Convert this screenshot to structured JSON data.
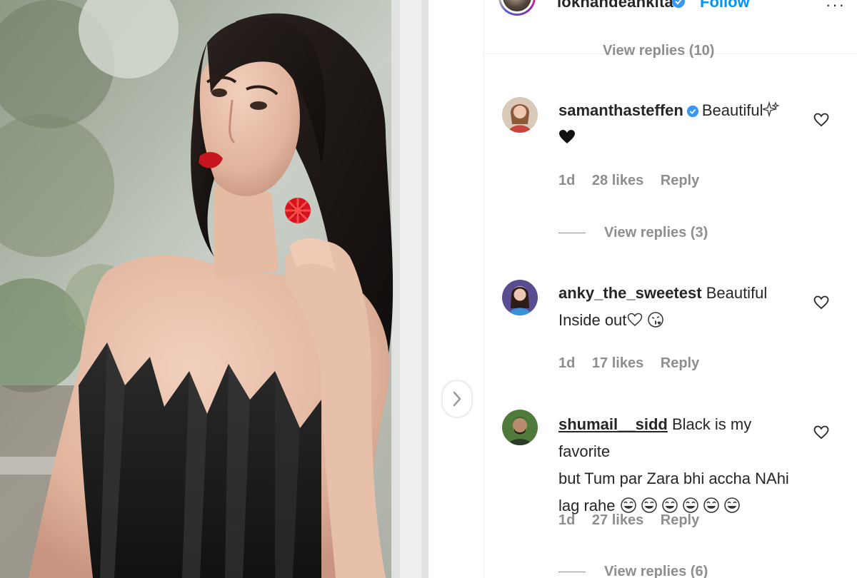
{
  "post": {
    "author": "lokhandeankita",
    "follow_label": "Follow",
    "more_label": "···",
    "previous_view_replies": "View replies (10)"
  },
  "comments": [
    {
      "username": "samanthasteffen",
      "verified": true,
      "text_line1": "Beautiful",
      "time": "1d",
      "likes": "28 likes",
      "reply_label": "Reply",
      "view_replies": "View replies (3)"
    },
    {
      "username": "anky_the_sweetest",
      "verified": false,
      "text_line1": "Beautiful",
      "text_line2": "Inside out",
      "time": "1d",
      "likes": "17 likes",
      "reply_label": "Reply"
    },
    {
      "username": "shumail__sidd",
      "verified": false,
      "text_line1": "Black is my favorite",
      "text_line2": "but Tum par Zara bhi accha NAhi",
      "text_line3": "lag rahe",
      "time": "1d",
      "likes": "27 likes",
      "reply_label": "Reply",
      "view_replies": "View replies (6)"
    }
  ],
  "icons": {
    "verified_badge": "verified-icon",
    "like": "heart-outline-icon",
    "next": "chevron-right-icon"
  },
  "colors": {
    "link_blue": "#0095f6",
    "verified_blue": "#3897f0",
    "muted_text": "#8e8e8e",
    "dress": "#1e1e1e",
    "lipstick": "#c4161c"
  }
}
